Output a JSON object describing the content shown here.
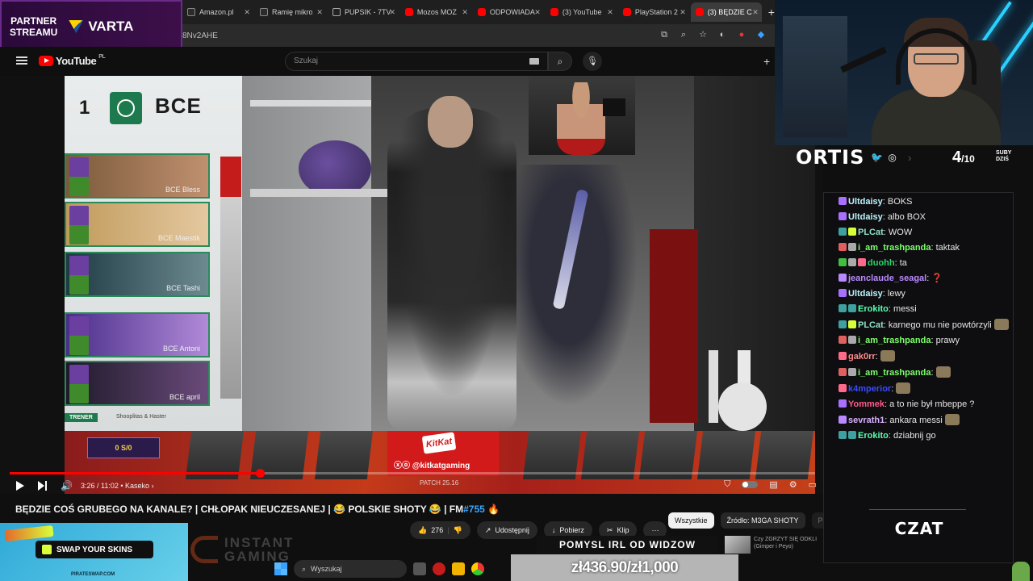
{
  "browser": {
    "tabs": [
      {
        "label": "Amazon.pl",
        "favicon": "amazon"
      },
      {
        "label": "Ramię mikro",
        "favicon": "amazon"
      },
      {
        "label": "PUPSIK - 7TV",
        "favicon": "7tv"
      },
      {
        "label": "Mozos MOZ",
        "favicon": "youtube"
      },
      {
        "label": "ODPOWIADA",
        "favicon": "youtube"
      },
      {
        "label": "(3) YouTube",
        "favicon": "youtube"
      },
      {
        "label": "PlayStation 2",
        "favicon": "youtube"
      },
      {
        "label": "(3) BĘDZIE C",
        "favicon": "youtube",
        "active": true
      }
    ],
    "url": "8Nv2AHE"
  },
  "partner_overlay": {
    "label_line1": "PARTNER",
    "label_line2": "STREAMU",
    "sponsor": "VARTA"
  },
  "youtube": {
    "logo_text": "YouTube",
    "country": "PL",
    "search_placeholder": "Szukaj"
  },
  "video_overlay": {
    "rank": "1",
    "team": "BCE",
    "players": [
      "BCE Bless",
      "BCE Maestik",
      "BCE Tashi",
      "BCE Antoni",
      "BCE april"
    ],
    "coach_label": "TRENER",
    "coaches": "Shooplitas & Haster",
    "score": "0 S/0",
    "sponsor_handle": "@kitkatgaming",
    "sponsor_logo": "KitKat",
    "patch": "PATCH 25.16"
  },
  "player": {
    "timecode": "3:26 / 11:02",
    "chapter": "Kaseko",
    "progress_fraction": 0.311
  },
  "video": {
    "title": "BĘDZIE COŚ GRUBEGO NA KANALE? | CHŁOPAK NIEUCZESANEJ | 😂 POLSKIE SHOTY 😂 | FM",
    "title_tag": "#755",
    "likes": "276",
    "share_label": "Udostępnij",
    "download_label": "Pobierz",
    "clip_label": "Klip",
    "more_label": "···"
  },
  "filters": [
    "Wszystkie",
    "Źródło: M3GA SHOTY",
    "Podobn"
  ],
  "stream": {
    "name": "ORTIS",
    "subs_current": "4",
    "subs_goal": "/10",
    "subs_label": "SUBY DZIŚ",
    "chat_label": "CZAT"
  },
  "chat": [
    {
      "user": "Ultdaisy",
      "color": "#bbf4ff",
      "badges": [
        "#a970ff"
      ],
      "text": "BOKS"
    },
    {
      "user": "Ultdaisy",
      "color": "#bbf4ff",
      "badges": [
        "#a970ff"
      ],
      "text": "albo BOX"
    },
    {
      "user": "PLCat",
      "color": "#8fe0c6",
      "badges": [
        "#3fa0a0",
        "#d9ff3a"
      ],
      "text": "WOW"
    },
    {
      "user": "i_am_trashpanda",
      "color": "#7cff6a",
      "badges": [
        "#e06060",
        "#aaaaaa"
      ],
      "text": "taktak"
    },
    {
      "user": "duohh",
      "color": "#2bd66a",
      "badges": [
        "#3fbf3f",
        "#aaaaaa",
        "#ff6a8a"
      ],
      "text": "ta"
    },
    {
      "user": "jeanclaude_seagal",
      "color": "#b98aff",
      "badges": [
        "#b98aff"
      ],
      "text": "❓"
    },
    {
      "user": "Ultdaisy",
      "color": "#bbf4ff",
      "badges": [
        "#a970ff"
      ],
      "text": "lewy"
    },
    {
      "user": "Erokito",
      "color": "#5affb0",
      "badges": [
        "#3fa0a0",
        "#3fa0a0"
      ],
      "text": "messi"
    },
    {
      "user": "PLCat",
      "color": "#8fe0c6",
      "badges": [
        "#3fa0a0",
        "#d9ff3a"
      ],
      "text": "karnego mu nie powtórzyli"
    },
    {
      "user": "i_am_trashpanda",
      "color": "#7cff6a",
      "badges": [
        "#e06060",
        "#aaaaaa"
      ],
      "text": "prawy"
    },
    {
      "user": "gak0rr",
      "color": "#ff8a8a",
      "badges": [
        "#ff6a8a"
      ],
      "text": ""
    },
    {
      "user": "i_am_trashpanda",
      "color": "#7cff6a",
      "badges": [
        "#e06060",
        "#aaaaaa"
      ],
      "text": ""
    },
    {
      "user": "k4mperior",
      "color": "#3a4aff",
      "badges": [
        "#ff6a8a"
      ],
      "text": ""
    },
    {
      "user": "Yommek",
      "color": "#ff5a8a",
      "badges": [
        "#a970ff"
      ],
      "text": "a to nie był mbeppe ?"
    },
    {
      "user": "sevrath1",
      "color": "#d8b0ff",
      "badges": [
        "#b98aff"
      ],
      "text": "ankara messi"
    },
    {
      "user": "Erokito",
      "color": "#5affb0",
      "badges": [
        "#3fa0a0",
        "#3fa0a0"
      ],
      "text": "dziabnij go"
    }
  ],
  "ads": {
    "swap_label": "SWAP YOUR SKINS",
    "swap_site": "PIRATESWAP.COM",
    "instant_line1": "INSTANT",
    "instant_line2": "GAMING"
  },
  "taskbar": {
    "search_label": "Wyszukaj"
  },
  "promo": {
    "banner": "POMYSL IRL OD WIDZOW",
    "side_text": "Czy ZGRZYT SIĘ ODKLI (Gimper i Peyo)",
    "goal": "zł436.90/zł1,000"
  }
}
